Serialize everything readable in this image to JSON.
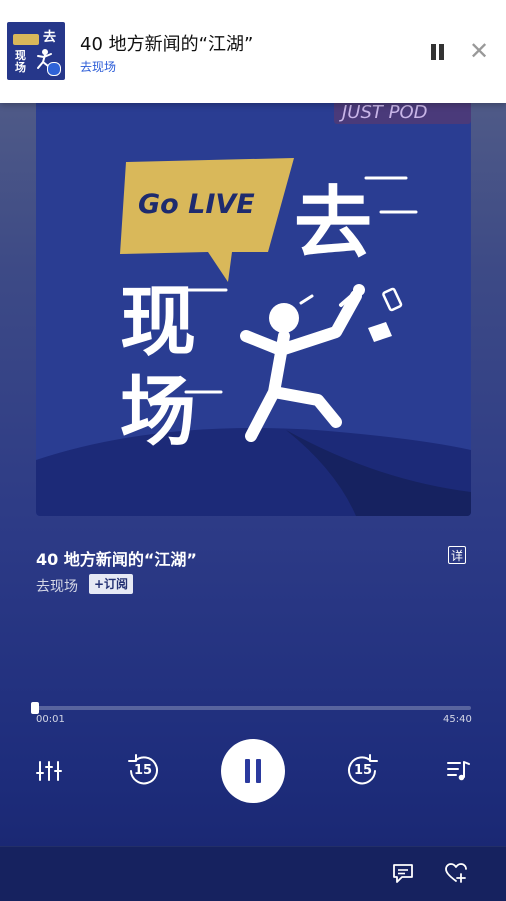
{
  "notification": {
    "title": "40 地方新闻的“江湖”",
    "podcast": "去现场",
    "thumb_chars": [
      "去",
      "现",
      "场"
    ],
    "thumb_badge_text": "GoLIVE"
  },
  "cover": {
    "bubble_text": "Go LIVE",
    "big_chars": [
      "去",
      "现",
      "场"
    ],
    "corner_text": "JUST POD",
    "colors": {
      "background": "#2a3d92",
      "bubble": "#d9b85a",
      "hill": "#1c2a78"
    }
  },
  "episode": {
    "title": "40 地方新闻的“江湖”",
    "podcast_name": "去现场",
    "subscribe_label": "+订阅",
    "detail_label": "详"
  },
  "player": {
    "current_time": "00:01",
    "total_time": "45:40",
    "progress": 0.0004,
    "skip_back_seconds": "15",
    "skip_forward_seconds": "15",
    "state": "playing"
  },
  "icons": {
    "equalizer": "equalizer-icon",
    "rewind": "rewind-15-icon",
    "pause": "pause-icon",
    "forward": "forward-15-icon",
    "playlist": "playlist-icon",
    "comment": "comment-icon",
    "favorite": "heart-add-icon",
    "close": "close-icon"
  }
}
